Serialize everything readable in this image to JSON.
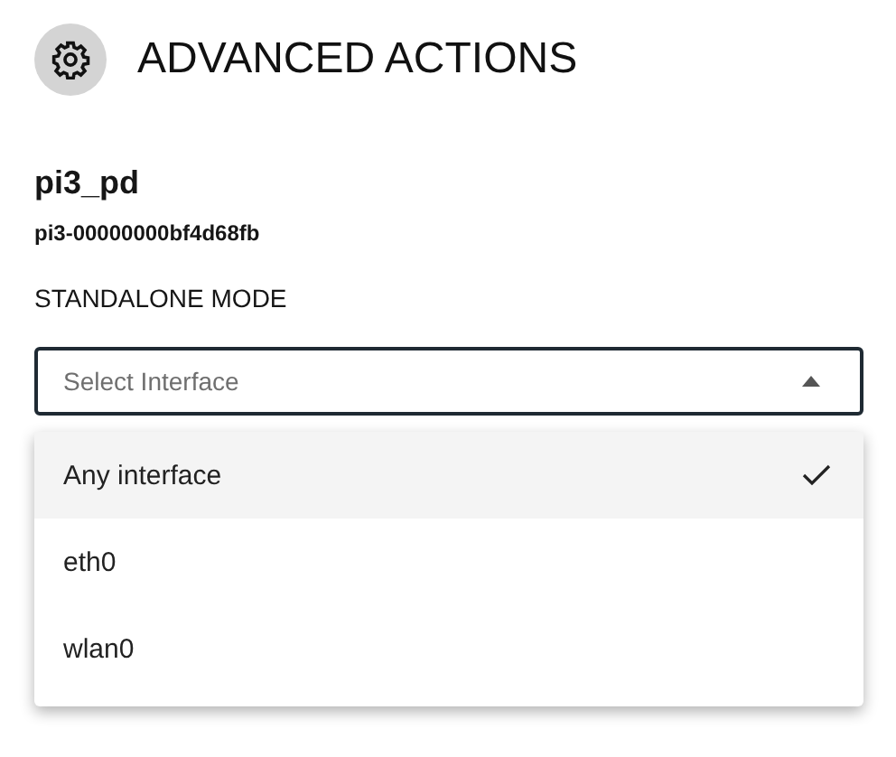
{
  "header": {
    "title": "ADVANCED ACTIONS"
  },
  "device": {
    "name": "pi3_pd",
    "id": "pi3-00000000bf4d68fb"
  },
  "section": {
    "label": "STANDALONE MODE"
  },
  "select": {
    "placeholder": "Select Interface",
    "expanded": true
  },
  "options": [
    {
      "label": "Any interface",
      "selected": true
    },
    {
      "label": "eth0",
      "selected": false
    },
    {
      "label": "wlan0",
      "selected": false
    }
  ]
}
